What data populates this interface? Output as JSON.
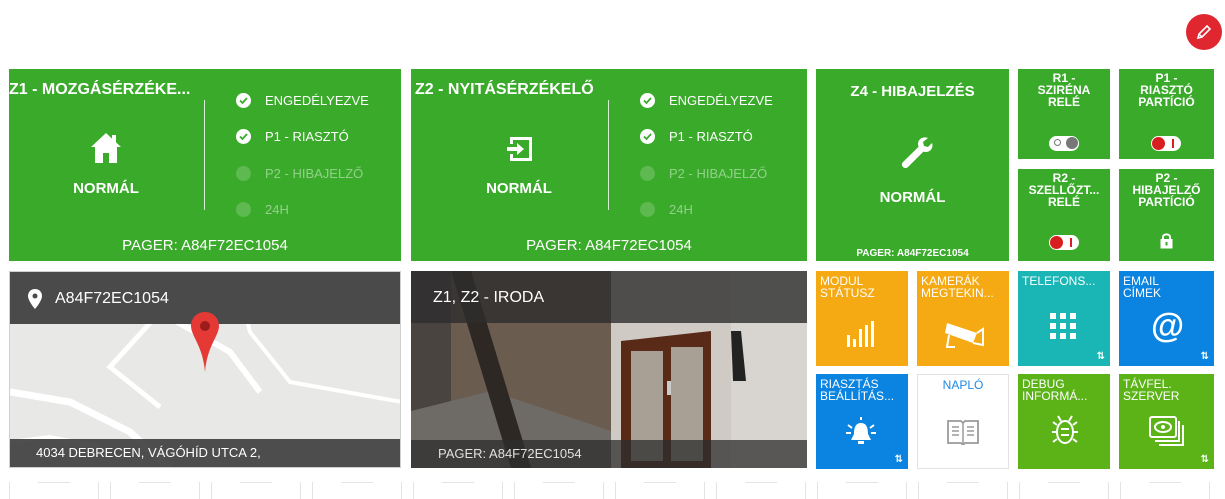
{
  "zones": [
    {
      "title": "Z1 - MOZGÁSÉRZÉKE...",
      "status": "NORMÁL",
      "icon": "home-icon",
      "pager": "PAGER: A84F72EC1054",
      "items": [
        {
          "label": "ENGEDÉLYEZVE",
          "active": true
        },
        {
          "label": "P1 - RIASZTÓ",
          "active": true
        },
        {
          "label": "P2 - HIBAJELZŐ",
          "active": false
        },
        {
          "label": "24H",
          "active": false
        }
      ]
    },
    {
      "title": "Z2 - NYITÁSÉRZÉKELŐ",
      "status": "NORMÁL",
      "icon": "door-enter-icon",
      "pager": "PAGER: A84F72EC1054",
      "items": [
        {
          "label": "ENGEDÉLYEZVE",
          "active": true
        },
        {
          "label": "P1 - RIASZTÓ",
          "active": true
        },
        {
          "label": "P2 - HIBAJELZŐ",
          "active": false
        },
        {
          "label": "24H",
          "active": false
        }
      ]
    },
    {
      "title": "Z4 - HIBAJELZÉS",
      "status": "NORMÁL",
      "icon": "wrench-icon",
      "pager": "PAGER: A84F72EC1054"
    }
  ],
  "relays": [
    {
      "line1": "R1 -",
      "line2": "SZIRÉNA",
      "line3": "RELÉ",
      "state": "off"
    },
    {
      "line1": "P1 -",
      "line2": "RIASZTÓ",
      "line3": "PARTÍCIÓ",
      "state": "on"
    },
    {
      "line1": "R2 -",
      "line2": "SZELLŐZT...",
      "line3": "RELÉ",
      "state": "on"
    },
    {
      "line1": "P2 -",
      "line2": "HIBAJELZŐ",
      "line3": "PARTÍCIÓ",
      "state": "lock"
    }
  ],
  "map": {
    "title": "A84F72EC1054",
    "address": "4034 DEBRECEN, VÁGÓHÍD UTCA 2,"
  },
  "camera": {
    "title": "Z1, Z2 - IRODA",
    "pager": "PAGER: A84F72EC1054"
  },
  "apps": [
    {
      "line1": "MODUL",
      "line2": "STÁTUSZ",
      "icon": "bar-chart-icon",
      "color": "#f5a912"
    },
    {
      "line1": "KAMERÁK",
      "line2": "MEGTEKIN...",
      "icon": "cctv-camera-icon",
      "color": "#f5a912"
    },
    {
      "line1": "TELEFONS...",
      "line2": "",
      "icon": "keypad-icon",
      "color": "#1ab6b6",
      "settings": "⇅"
    },
    {
      "line1": "EMAIL",
      "line2": "CÍMEK",
      "icon": "at-sign-icon",
      "color": "#0a84e0",
      "settings": "⇅"
    },
    {
      "line1": "RIASZTÁS",
      "line2": "BEÁLLÍTÁS...",
      "icon": "alarm-icon",
      "color": "#0a84e0",
      "settings": "⇅"
    },
    {
      "line1": "NAPLÓ",
      "line2": "",
      "icon": "book-icon",
      "color": "#ffffff"
    },
    {
      "line1": "DEBUG",
      "line2": "INFORMÁ...",
      "icon": "bug-icon",
      "color": "#5bb318"
    },
    {
      "line1": "TÁVFEL.",
      "line2": "SZERVER",
      "icon": "server-icon",
      "color": "#5bb318",
      "settings": "⇅"
    }
  ],
  "edit_icon": "pencil-icon"
}
